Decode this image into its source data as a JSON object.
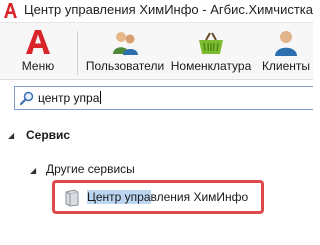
{
  "window": {
    "title": "Центр управления ХимИнфо - Агбис.Химчистка"
  },
  "ribbon": {
    "menu_label": "Меню",
    "users_label": "Пользователи",
    "nomenclature_label": "Номенклатура",
    "clients_label": "Клиенты"
  },
  "search": {
    "value": "центр упра"
  },
  "tree": {
    "group_label": "Сервис",
    "subgroup_label": "Другие сервисы",
    "item": {
      "label_match_1": "Центр упра",
      "label_rest": "вления ХимИнфо"
    }
  },
  "colors": {
    "highlight_border": "#e0494b",
    "selection": "#bcd6f2",
    "brand_red": "#d9252a"
  }
}
